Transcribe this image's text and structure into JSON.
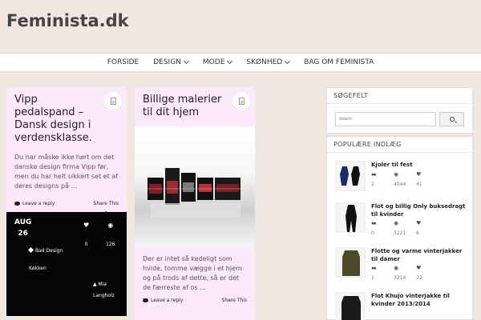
{
  "site": {
    "title": "Feminista.dk"
  },
  "nav": {
    "items": [
      {
        "label": "FORSIDE",
        "has_dropdown": false
      },
      {
        "label": "DESIGN",
        "has_dropdown": true
      },
      {
        "label": "MODE",
        "has_dropdown": true
      },
      {
        "label": "SKØNHED",
        "has_dropdown": true
      },
      {
        "label": "BAG OM FEMINISTA",
        "has_dropdown": false
      }
    ]
  },
  "posts": [
    {
      "title": "Vipp pedalspand – Dansk design i verdensklasse.",
      "excerpt": "Du har måske ikke hørt om det danske design firma Vipp før, men du har helt sikkert set et af deres designs på …",
      "leave_reply": "Leave a reply",
      "share": "Share This",
      "meta": {
        "month": "AUG",
        "day": "26",
        "likes": "0",
        "views": "126",
        "category": "Bad Design Køkken",
        "author": "Mia Langholz"
      }
    },
    {
      "title": "Billige malerier til dit hjem",
      "excerpt": "Der er intet så kedeligt som hvide, tomme vægge i et hjem og på trods af dette, så er det de færreste af os …",
      "leave_reply": "Leave a reply",
      "share": "Share This"
    }
  ],
  "sidebar": {
    "search": {
      "title": "SØGEFELT",
      "placeholder": "Search"
    },
    "popular": {
      "title": "POPULÆRE INDLÆG",
      "items": [
        {
          "title": "Kjoler til fest",
          "comments": "2",
          "views": "4044",
          "likes": "41"
        },
        {
          "title": "Flot og billig Only buksedragt til kvinder",
          "comments": "0",
          "views": "3221",
          "likes": "6"
        },
        {
          "title": "Flotte og varme vinterjakker til damer",
          "comments": "1",
          "views": "3214",
          "likes": "22"
        },
        {
          "title": "Flot Khujo vinterjakke til kvinder 2013/2014",
          "comments": "",
          "views": "",
          "likes": ""
        }
      ]
    }
  },
  "colors": {
    "card_bg": "#fbe9fb",
    "page_bg": "#efe7e0",
    "meta_bg": "#050505"
  }
}
